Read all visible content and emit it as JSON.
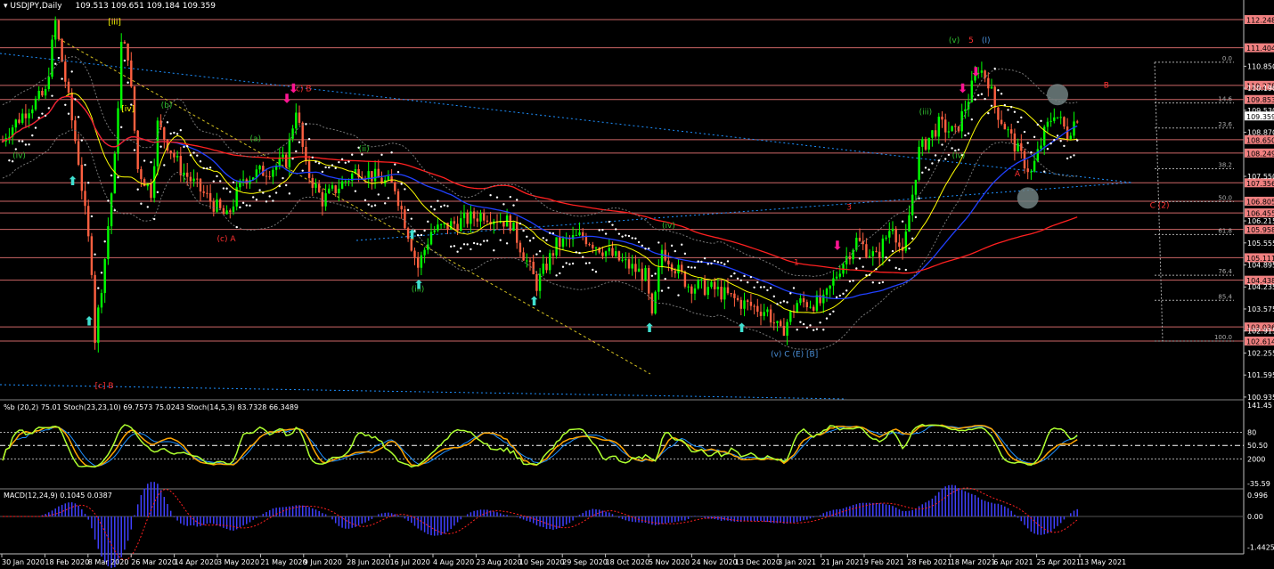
{
  "header": {
    "symbol_label": "USDJPY,Daily",
    "ohlc": "109.513 109.651 109.184 109.359"
  },
  "colors": {
    "bull": "#00ff00",
    "bear": "#ff6040",
    "ma_fast": "#ffff00",
    "ma_mid": "#2040ff",
    "ma_slow": "#ff2020",
    "level": "#ff8080",
    "sar": "#ffffff",
    "stoch_fast": "#adff2f",
    "stoch_slow": "#ffa500",
    "bb": "#1e90ff",
    "macd": "#4040ff",
    "macd_signal": "#ff2020"
  },
  "chart_data": {
    "type": "candlestick",
    "title": "USDJPY,Daily",
    "ylim": [
      100.935,
      112.6
    ],
    "bars": 327,
    "price_waypoints": [
      [
        0,
        108.6
      ],
      [
        1,
        108.83
      ],
      [
        8,
        109.63
      ],
      [
        13,
        110.03
      ],
      [
        16,
        112.17
      ],
      [
        19,
        110.43
      ],
      [
        23,
        108.03
      ],
      [
        27,
        104.83
      ],
      [
        28,
        102.7
      ],
      [
        31,
        105.1
      ],
      [
        34,
        108.03
      ],
      [
        36,
        111.5
      ],
      [
        38,
        111.23
      ],
      [
        41,
        107.77
      ],
      [
        45,
        107.1
      ],
      [
        47,
        109.1
      ],
      [
        54,
        107.77
      ],
      [
        59,
        107.23
      ],
      [
        68,
        106.3
      ],
      [
        73,
        107.5
      ],
      [
        81,
        107.77
      ],
      [
        86,
        108.03
      ],
      [
        89,
        109.63
      ],
      [
        92,
        107.77
      ],
      [
        97,
        106.83
      ],
      [
        108,
        107.77
      ],
      [
        119,
        107.23
      ],
      [
        126,
        104.83
      ],
      [
        130,
        105.9
      ],
      [
        138,
        106.16
      ],
      [
        146,
        106.43
      ],
      [
        154,
        106.16
      ],
      [
        162,
        104.3
      ],
      [
        168,
        105.5
      ],
      [
        176,
        105.76
      ],
      [
        186,
        105.1
      ],
      [
        195,
        104.56
      ],
      [
        197,
        103.23
      ],
      [
        200,
        105.36
      ],
      [
        208,
        104.3
      ],
      [
        216,
        104.16
      ],
      [
        224,
        103.76
      ],
      [
        232,
        103.5
      ],
      [
        236,
        102.83
      ],
      [
        241,
        103.76
      ],
      [
        249,
        103.76
      ],
      [
        254,
        104.83
      ],
      [
        259,
        105.63
      ],
      [
        265,
        105.1
      ],
      [
        270,
        106.16
      ],
      [
        273,
        105.1
      ],
      [
        278,
        108.3
      ],
      [
        284,
        109.1
      ],
      [
        289,
        108.83
      ],
      [
        293,
        109.9
      ],
      [
        296,
        110.83
      ],
      [
        299,
        110.43
      ],
      [
        301,
        109.63
      ],
      [
        308,
        108.3
      ],
      [
        312,
        107.63
      ],
      [
        316,
        108.83
      ],
      [
        319,
        109.5
      ],
      [
        323,
        108.83
      ],
      [
        326,
        109.36
      ]
    ],
    "x_tick_labels": [
      "30 Jan 2020",
      "18 Feb 2020",
      "8 Mar 2020",
      "26 Mar 2020",
      "14 Apr 2020",
      "3 May 2020",
      "21 May 2020",
      "9 Jun 2020",
      "28 Jun 2020",
      "16 Jul 2020",
      "4 Aug 2020",
      "23 Aug 2020",
      "10 Sep 2020",
      "29 Sep 2020",
      "18 Oct 2020",
      "5 Nov 2020",
      "24 Nov 2020",
      "13 Dec 2020",
      "3 Jan 2021",
      "21 Jan 2021",
      "9 Feb 2021",
      "28 Feb 2021",
      "18 Mar 2021",
      "6 Apr 2021",
      "25 Apr 2021",
      "13 May 2021"
    ],
    "y_tick_labels": [
      "110.850",
      "110.190",
      "109.530",
      "108.870",
      "107.550",
      "106.215",
      "105.555",
      "104.895",
      "104.235",
      "103.575",
      "102.915",
      "102.255",
      "101.595",
      "100.935"
    ],
    "levels": [
      "112.248",
      "111.404",
      "110.278",
      "109.853",
      "108.650",
      "108.249",
      "107.356",
      "106.805",
      "106.455",
      "105.958",
      "105.111",
      "104.438",
      "103.036",
      "102.614"
    ],
    "current_price": "109.359",
    "fib_levels": [
      "0.0",
      "14.6",
      "23.6",
      "38.2",
      "50.0",
      "61.8",
      "76.4",
      "85.4",
      "100.0"
    ],
    "fib_range": [
      110.97,
      102.614
    ],
    "wave_labels": [
      {
        "t": "5",
        "bar": 293,
        "p": 111.55,
        "c": "#ff3030"
      },
      {
        "t": "(I)",
        "bar": 297,
        "p": 111.55,
        "c": "#4a90d9"
      },
      {
        "t": "(v)",
        "bar": 287,
        "p": 111.55,
        "c": "#30c030"
      },
      {
        "t": "B",
        "bar": 334,
        "p": 110.2,
        "c": "#ff3030"
      },
      {
        "t": "A",
        "bar": 307,
        "p": 107.55,
        "c": "#ff3030"
      },
      {
        "t": "C (2)",
        "bar": 348,
        "p": 106.6,
        "c": "#ff3030"
      },
      {
        "t": "3",
        "bar": 256,
        "p": 106.55,
        "c": "#ff3030"
      },
      {
        "t": "1",
        "bar": 240,
        "p": 104.9,
        "c": "#ff3030"
      },
      {
        "t": "(v) C (E) [B]",
        "bar": 233,
        "p": 102.15,
        "c": "#4a90d9"
      },
      {
        "t": "(iii)",
        "bar": 124,
        "p": 104.1,
        "c": "#30c030"
      },
      {
        "t": "(c) B",
        "bar": 88,
        "p": 110.1,
        "c": "#ff3030"
      },
      {
        "t": "(c) A",
        "bar": 65,
        "p": 105.6,
        "c": "#ff3030"
      },
      {
        "t": "[iii]",
        "bar": 32,
        "p": 112.1,
        "c": "#ffff00"
      },
      {
        "t": "[iv]",
        "bar": 36,
        "p": 109.5,
        "c": "#ffff00"
      },
      {
        "t": "[c] B",
        "bar": 28,
        "p": 101.2,
        "c": "#ff3030"
      },
      {
        "t": "(b)",
        "bar": 48,
        "p": 109.6,
        "c": "#30c030"
      },
      {
        "t": "(a)",
        "bar": 75,
        "p": 108.6,
        "c": "#30c030"
      },
      {
        "t": "(ii)",
        "bar": 108,
        "p": 108.3,
        "c": "#30c030"
      },
      {
        "t": "(iv)",
        "bar": 200,
        "p": 106.0,
        "c": "#30c030"
      },
      {
        "t": "(iii)",
        "bar": 278,
        "p": 109.4,
        "c": "#30c030"
      },
      {
        "t": "(iv)",
        "bar": 288,
        "p": 108.1,
        "c": "#30c030"
      },
      {
        "t": "(iv)",
        "bar": 3,
        "p": 108.1,
        "c": "#30c030"
      }
    ],
    "buy_arrows": [
      [
        21,
        107.6
      ],
      [
        26,
        103.4
      ],
      [
        124,
        106.0
      ],
      [
        126,
        104.5
      ],
      [
        161,
        104.0
      ],
      [
        196,
        103.2
      ],
      [
        224,
        103.2
      ]
    ],
    "sell_arrows": [
      [
        88,
        110.0
      ],
      [
        86,
        109.7
      ],
      [
        253,
        105.3
      ],
      [
        295,
        110.5
      ],
      [
        291,
        110.0
      ]
    ],
    "circles": [
      [
        320,
        110.0
      ],
      [
        311,
        106.9
      ]
    ],
    "osc": {
      "label": "%b (20,2) 75.01  Stoch(23,23,10) 69.7573 75.0243  Stoch(14,5,3) 83.7328 66.3489",
      "ticks": [
        "141.45",
        "80",
        "50.50",
        "2000",
        "-35.59"
      ]
    },
    "macd": {
      "label": "MACD(12,24,9) 0.1045 0.0387",
      "ticks": [
        "0.996",
        "0.00",
        "-1.4425"
      ]
    }
  }
}
